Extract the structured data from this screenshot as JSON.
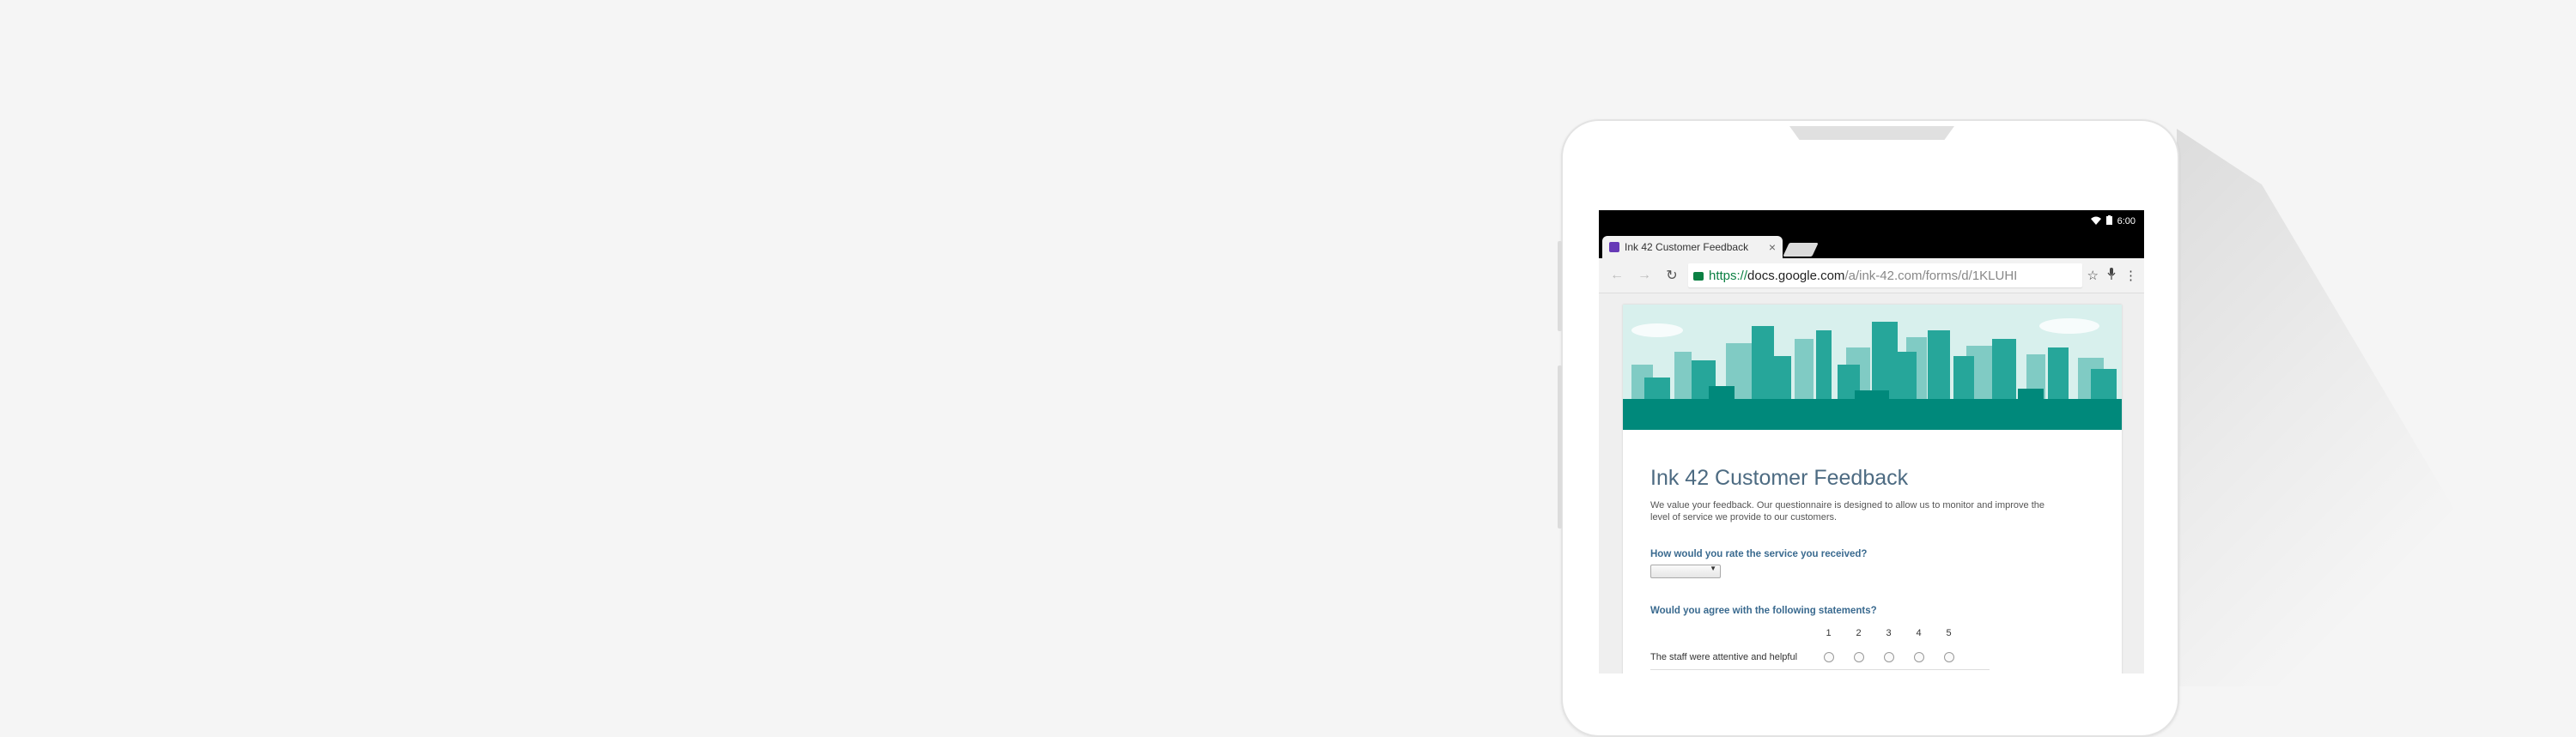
{
  "status_bar": {
    "time": "6:00"
  },
  "browser": {
    "tab_title": "Ink 42 Customer Feedback",
    "tab_close": "×",
    "url_scheme": "https://",
    "url_host": "docs.google.com",
    "url_path": "/a/ink-42.com/forms/d/1KLUHI"
  },
  "form": {
    "title": "Ink 42 Customer Feedback",
    "description": "We value your feedback. Our questionnaire is designed to allow us to monitor and improve the level of service we provide to our customers.",
    "question1": "How would you rate the service you received?",
    "question2": "Would you agree with the following statements?",
    "scale": [
      "1",
      "2",
      "3",
      "4",
      "5"
    ],
    "rows": [
      "The staff were attentive and helpful"
    ]
  },
  "colors": {
    "banner_teal": "#26a69a",
    "title": "#4d6b82",
    "question": "#3a6a8f"
  }
}
